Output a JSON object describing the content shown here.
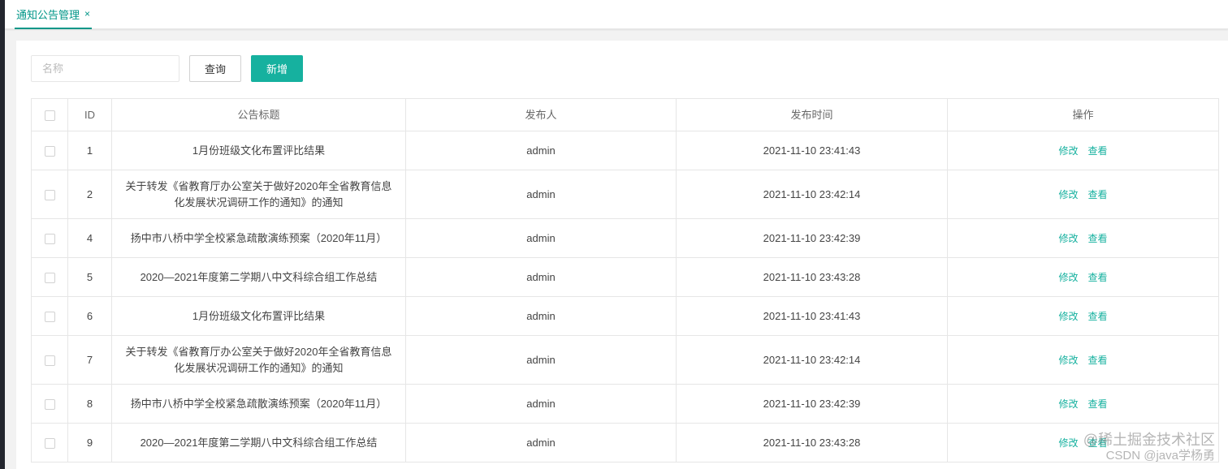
{
  "tabs": [
    {
      "label": "通知公告管理",
      "close": "×"
    }
  ],
  "toolbar": {
    "search_placeholder": "名称",
    "query_label": "查询",
    "add_label": "新增"
  },
  "table": {
    "columns": [
      "ID",
      "公告标题",
      "发布人",
      "发布时间",
      "操作"
    ],
    "actions": {
      "edit": "修改",
      "view": "查看"
    },
    "rows": [
      {
        "id": "1",
        "title": "1月份班级文化布置评比结果",
        "publisher": "admin",
        "time": "2021-11-10 23:41:43"
      },
      {
        "id": "2",
        "title": "关于转发《省教育厅办公室关于做好2020年全省教育信息化发展状况调研工作的通知》的通知",
        "publisher": "admin",
        "time": "2021-11-10 23:42:14"
      },
      {
        "id": "4",
        "title": "扬中市八桥中学全校紧急疏散演练预案（2020年11月）",
        "publisher": "admin",
        "time": "2021-11-10 23:42:39"
      },
      {
        "id": "5",
        "title": "2020—2021年度第二学期八中文科综合组工作总结",
        "publisher": "admin",
        "time": "2021-11-10 23:43:28"
      },
      {
        "id": "6",
        "title": "1月份班级文化布置评比结果",
        "publisher": "admin",
        "time": "2021-11-10 23:41:43"
      },
      {
        "id": "7",
        "title": "关于转发《省教育厅办公室关于做好2020年全省教育信息化发展状况调研工作的通知》的通知",
        "publisher": "admin",
        "time": "2021-11-10 23:42:14"
      },
      {
        "id": "8",
        "title": "扬中市八桥中学全校紧急疏散演练预案（2020年11月）",
        "publisher": "admin",
        "time": "2021-11-10 23:42:39"
      },
      {
        "id": "9",
        "title": "2020—2021年度第二学期八中文科综合组工作总结",
        "publisher": "admin",
        "time": "2021-11-10 23:43:28"
      }
    ]
  },
  "watermark": {
    "line1": "@稀土掘金技术社区",
    "line2": "CSDN @java学杨勇"
  },
  "colors": {
    "accent": "#16b19f",
    "tab_accent": "#009688",
    "border": "#e6e6e6"
  }
}
